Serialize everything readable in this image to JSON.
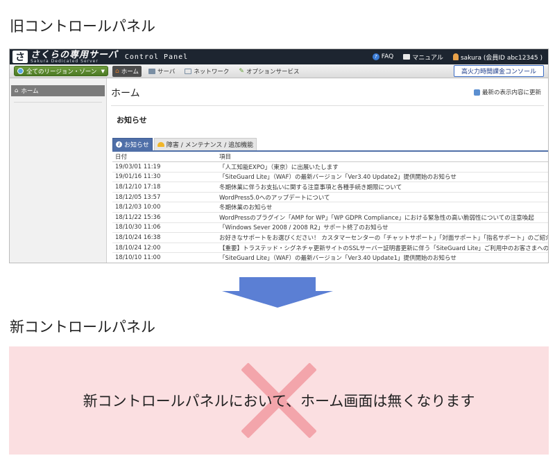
{
  "old_heading": "旧コントロールパネル",
  "new_heading": "新コントロールパネル",
  "old_panel": {
    "topbar": {
      "logo_mark": "さ",
      "logo_title": "さくらの専用サーバ",
      "logo_sub": "Sakura Dedicated Server",
      "app_title": "Control Panel",
      "faq": "FAQ",
      "manual": "マニュアル",
      "user": "sakura (会員ID abc12345 )"
    },
    "navbar": {
      "region": "全てのリージョン・ゾーン",
      "tabs": [
        "ホーム",
        "サーバ",
        "ネットワーク",
        "オプションサービス"
      ],
      "console_button": "高火力時間課金コンソール"
    },
    "sidebar": {
      "home": "ホーム"
    },
    "main": {
      "title": "ホーム",
      "refresh": "最新の表示内容に更新",
      "notice_title": "お知らせ",
      "tabs": [
        "お知らせ",
        "障害 / メンテナンス / 追加機能"
      ],
      "table": {
        "headers": [
          "日付",
          "項目"
        ],
        "rows": [
          {
            "date": "19/03/01 11:19",
            "item": "「人工知能EXPO」（東京）に出展いたします"
          },
          {
            "date": "19/01/16 11:30",
            "item": "「SiteGuard Lite」（WAF）の最新バージョン「Ver3.40 Update2」提供開始のお知らせ"
          },
          {
            "date": "18/12/10 17:18",
            "item": "冬期休業に伴うお支払いに関する注意事項と各種手続き期限について"
          },
          {
            "date": "18/12/05 13:57",
            "item": "WordPress5.0へのアップデートについて"
          },
          {
            "date": "18/12/03 10:00",
            "item": "冬期休業のお知らせ"
          },
          {
            "date": "18/11/22 15:36",
            "item": "WordPressのプラグイン「AMP for WP」「WP GDPR Compliance」における緊急性の高い脆弱性についての注意喚起"
          },
          {
            "date": "18/10/30 11:06",
            "item": "「Windows Sever 2008 / 2008 R2」サポート終了のお知らせ"
          },
          {
            "date": "18/10/24 16:38",
            "item": "お好きなサポートをお選びください！ カスタマーセンターの「チャットサポート」「対面サポート」「指名サポート」のご紹介"
          },
          {
            "date": "18/10/24 12:00",
            "item": "【重要】トラステッド・シグネチャ更新サイトのSSLサーバー証明書更新に伴う「SiteGuard Lite」ご利用中のお客さまへのお願い"
          },
          {
            "date": "18/10/10 11:00",
            "item": "「SiteGuard Lite」（WAF）の最新バージョン「Ver3.40 Update1」提供開始のお知らせ"
          }
        ]
      }
    }
  },
  "new_panel_message": "新コントロールパネルにおいて、ホーム画面は無くなります",
  "colors": {
    "arrow": "#5b7fd4",
    "new_box_bg": "#fbdfe1",
    "cross": "#f3a5ab",
    "topbar": "#1d2530"
  }
}
